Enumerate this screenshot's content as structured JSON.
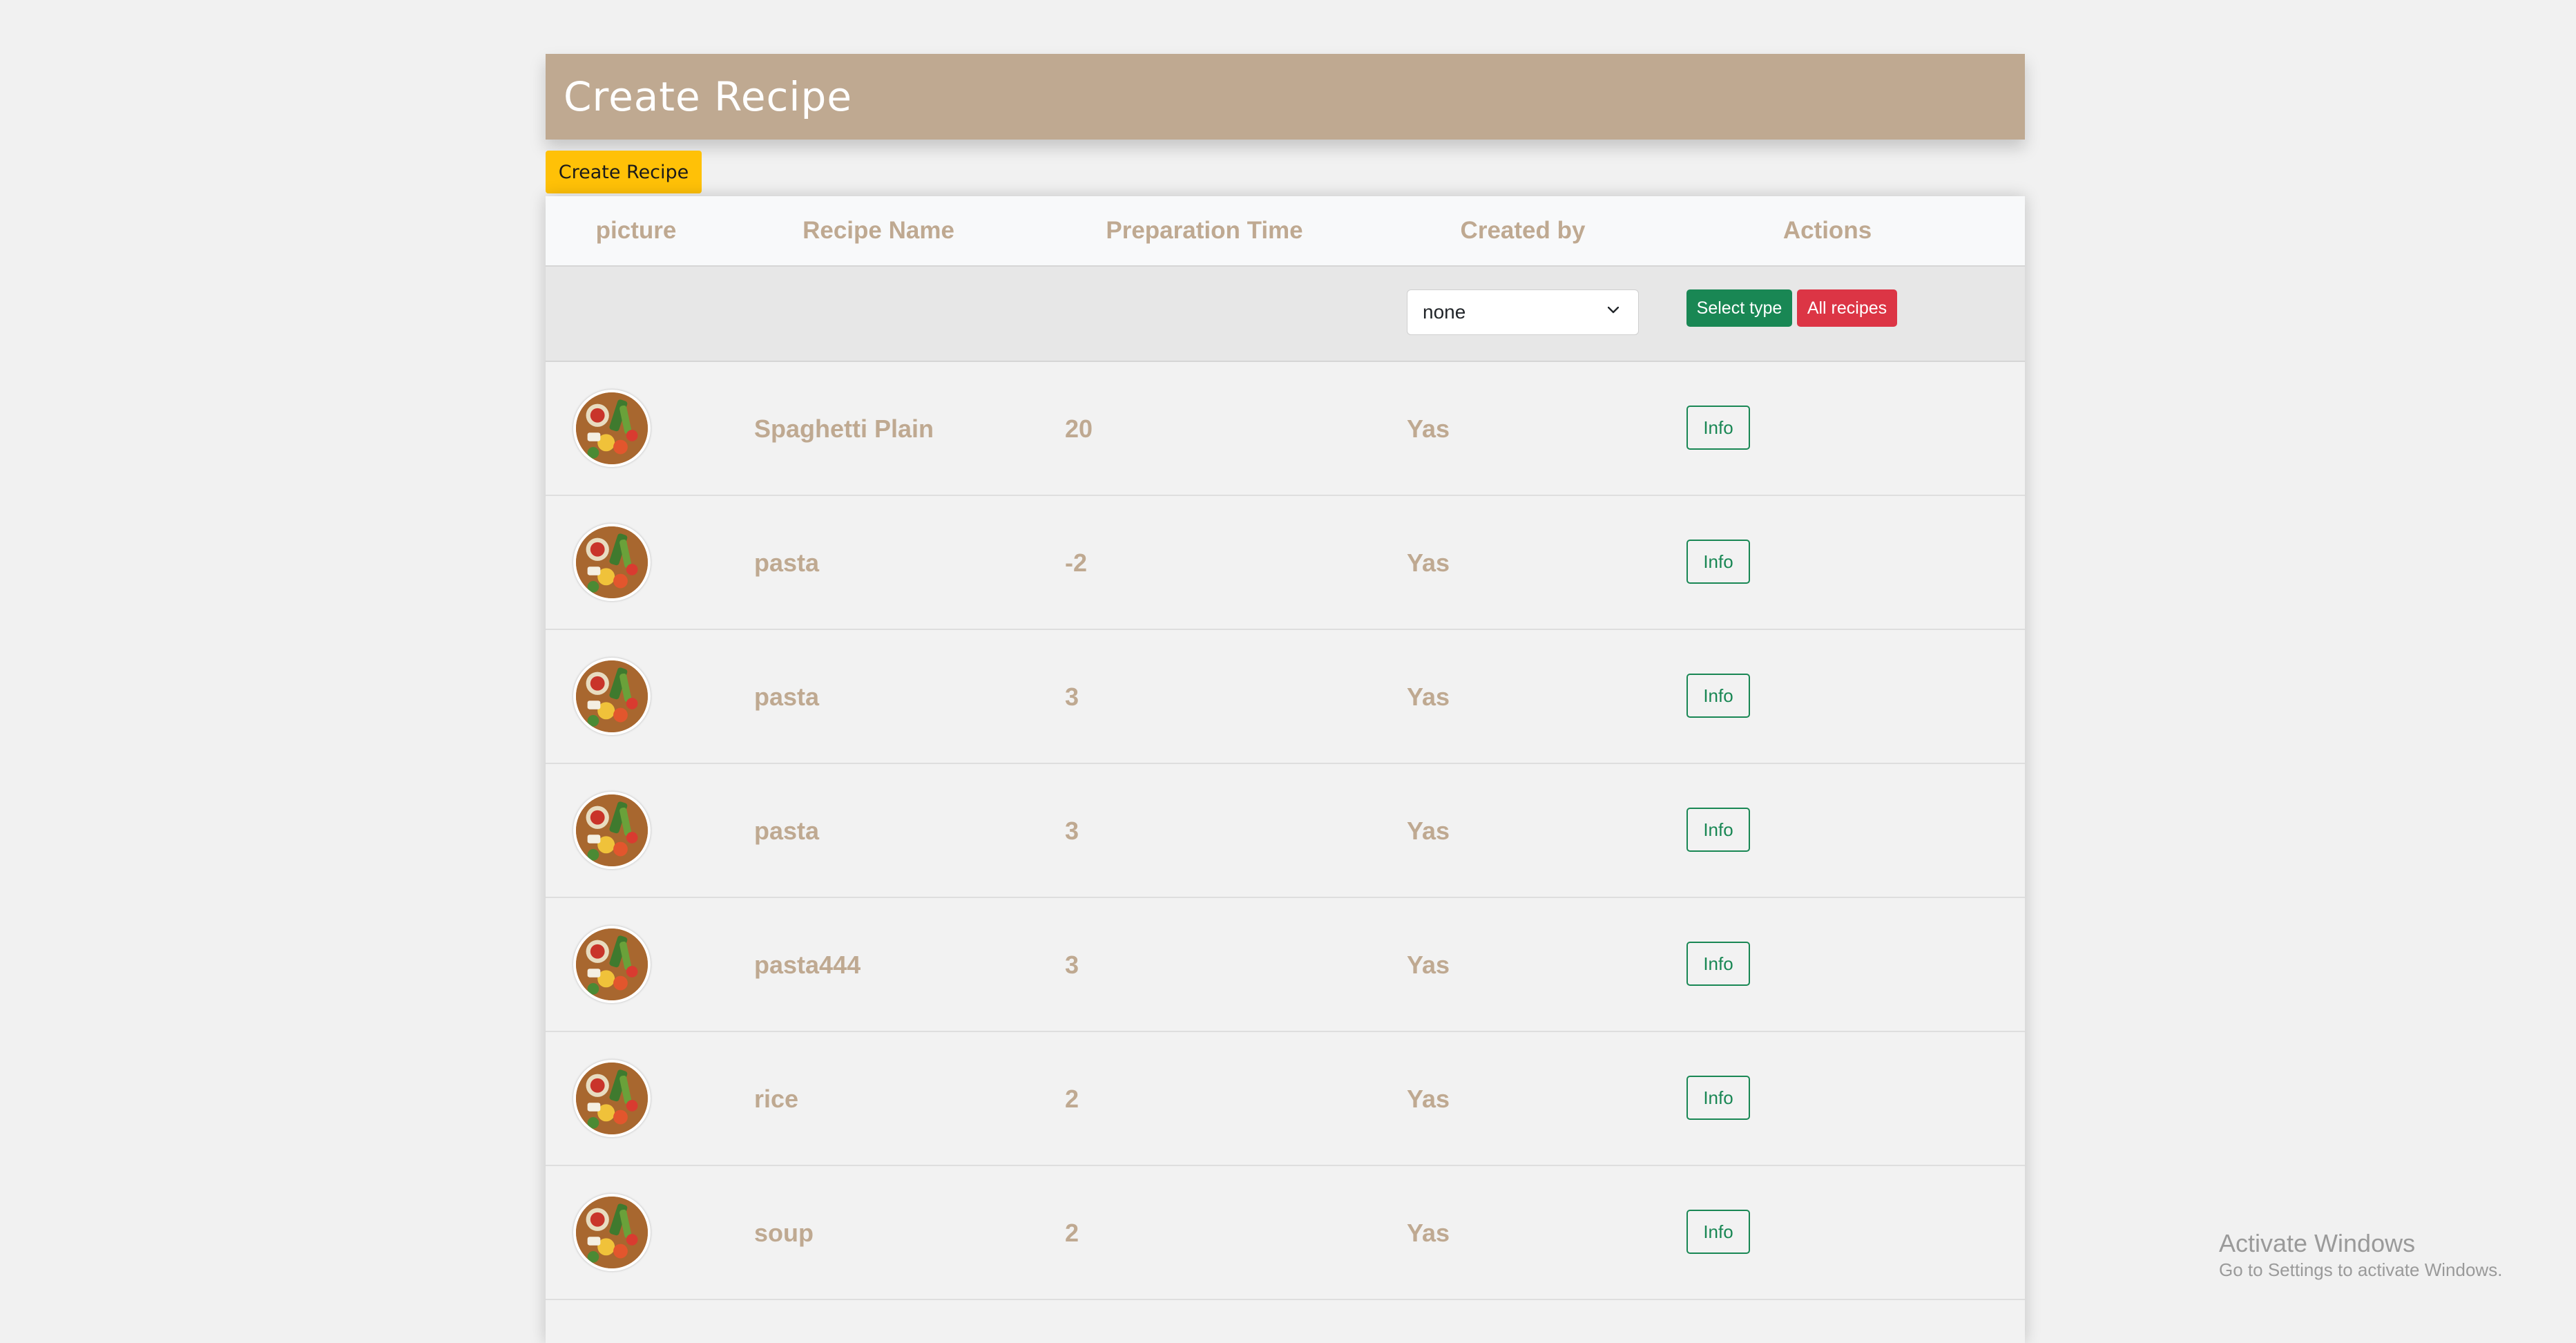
{
  "header": {
    "title": "Create Recipe",
    "create_button_label": "Create Recipe"
  },
  "table": {
    "columns": [
      "picture",
      "Recipe Name",
      "Preparation Time",
      "Created by",
      "Actions"
    ],
    "filter": {
      "selected_type": "none",
      "select_type_label": "Select type",
      "all_recipes_label": "All recipes"
    },
    "rows": [
      {
        "picture_icon": "recipe-thumbnail",
        "name": "Spaghetti Plain",
        "prep_time": "20",
        "created_by": "Yas",
        "action_label": "Info"
      },
      {
        "picture_icon": "recipe-thumbnail",
        "name": "pasta",
        "prep_time": "-2",
        "created_by": "Yas",
        "action_label": "Info"
      },
      {
        "picture_icon": "recipe-thumbnail",
        "name": "pasta",
        "prep_time": "3",
        "created_by": "Yas",
        "action_label": "Info"
      },
      {
        "picture_icon": "recipe-thumbnail",
        "name": "pasta",
        "prep_time": "3",
        "created_by": "Yas",
        "action_label": "Info"
      },
      {
        "picture_icon": "recipe-thumbnail",
        "name": "pasta444",
        "prep_time": "3",
        "created_by": "Yas",
        "action_label": "Info"
      },
      {
        "picture_icon": "recipe-thumbnail",
        "name": "rice",
        "prep_time": "2",
        "created_by": "Yas",
        "action_label": "Info"
      },
      {
        "picture_icon": "recipe-thumbnail",
        "name": "soup",
        "prep_time": "2",
        "created_by": "Yas",
        "action_label": "Info"
      }
    ]
  },
  "watermark": {
    "title": "Activate Windows",
    "subtitle": "Go to Settings to activate Windows."
  },
  "colors": {
    "header_bg": "#bfa991",
    "create_button": "#ffc107",
    "select_type_button": "#198754",
    "all_recipes_button": "#dc3545",
    "text_accent": "#bfa991"
  }
}
